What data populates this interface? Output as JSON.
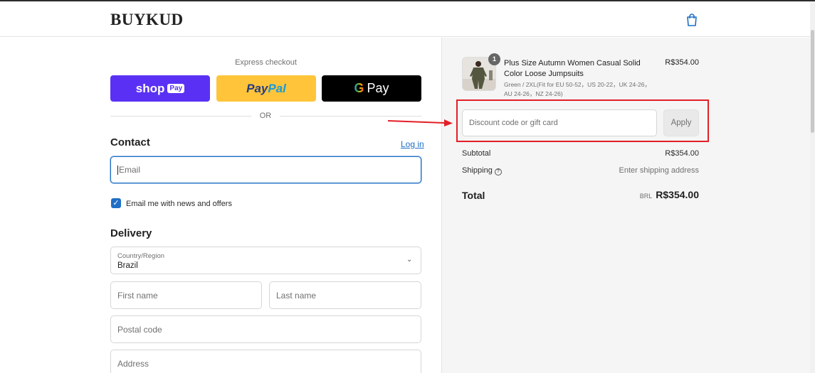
{
  "header": {
    "logo": "BUYKUD",
    "cart_icon": "shopping-bag-icon"
  },
  "express": {
    "label": "Express checkout",
    "shop_pay": {
      "word": "shop",
      "badge": "Pay"
    },
    "paypal": {
      "part1": "Pay",
      "part2": "Pal"
    },
    "gpay": {
      "g": "G",
      "word": "Pay"
    },
    "or_text": "OR"
  },
  "contact": {
    "title": "Contact",
    "login_link": "Log in",
    "email_placeholder": "Email",
    "newsletter_checked": true,
    "newsletter_label": "Email me with news and offers"
  },
  "delivery": {
    "title": "Delivery",
    "country": {
      "label": "Country/Region",
      "value": "Brazil"
    },
    "first_name_placeholder": "First name",
    "last_name_placeholder": "Last name",
    "postal_placeholder": "Postal code",
    "address_placeholder": "Address"
  },
  "order": {
    "item": {
      "quantity": "1",
      "title": "Plus Size Autumn Women Casual Solid Color Loose Jumpsuits",
      "variant": "Green / 2XL(Fit for EU 50-52，US 20-22，UK 24-26，AU 24-26，NZ 24-26)",
      "price": "R$354.00"
    },
    "discount_placeholder": "Discount code or gift card",
    "apply_label": "Apply",
    "subtotal_label": "Subtotal",
    "subtotal_value": "R$354.00",
    "shipping_label": "Shipping",
    "shipping_value": "Enter shipping address",
    "total_label": "Total",
    "total_currency": "BRL",
    "total_value": "R$354.00"
  },
  "colors": {
    "shop_pay": "#5a31f4",
    "paypal": "#ffc439",
    "link": "#1f6fc5",
    "highlight": "#e31f26"
  }
}
